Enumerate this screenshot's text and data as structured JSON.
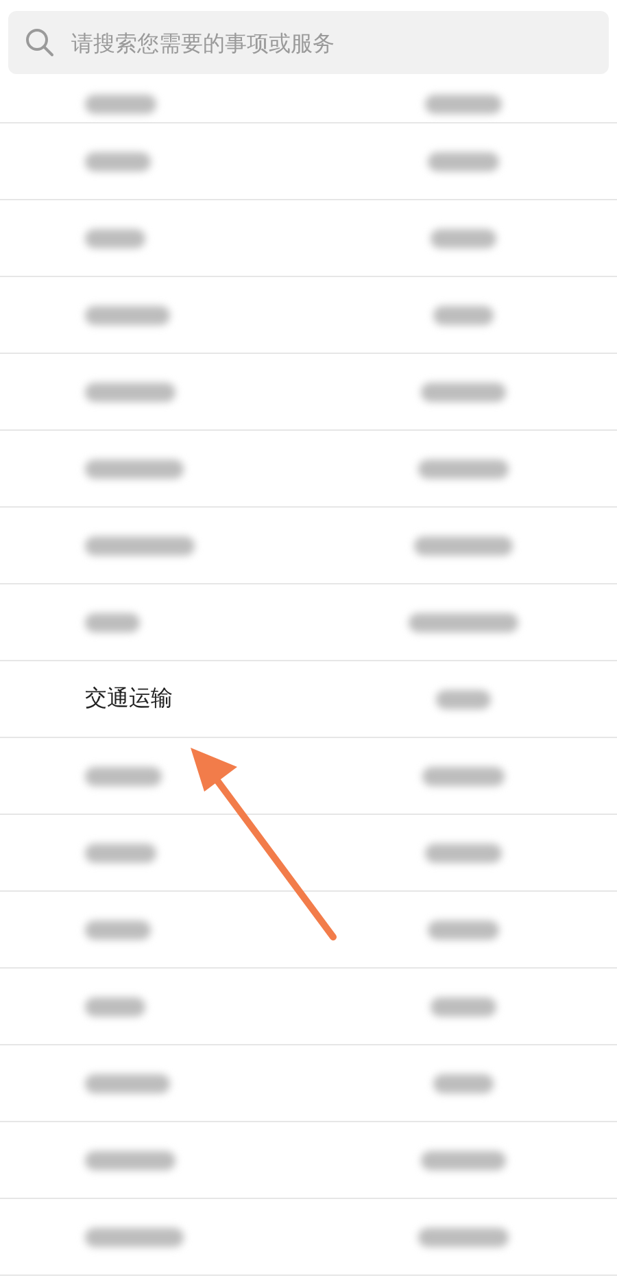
{
  "search": {
    "placeholder": "请搜索您需要的事项或服务"
  },
  "rows": [
    {
      "cells": [
        {
          "kind": "blurred"
        },
        {
          "kind": "blurred"
        }
      ]
    },
    {
      "cells": [
        {
          "kind": "blurred"
        },
        {
          "kind": "blurred"
        }
      ]
    },
    {
      "cells": [
        {
          "kind": "blurred"
        },
        {
          "kind": "blurred"
        }
      ]
    },
    {
      "cells": [
        {
          "kind": "blurred"
        },
        {
          "kind": "blurred"
        }
      ]
    },
    {
      "cells": [
        {
          "kind": "blurred"
        },
        {
          "kind": "blurred"
        }
      ]
    },
    {
      "cells": [
        {
          "kind": "blurred"
        },
        {
          "kind": "blurred"
        }
      ]
    },
    {
      "cells": [
        {
          "kind": "blurred"
        },
        {
          "kind": "blurred"
        }
      ]
    },
    {
      "cells": [
        {
          "kind": "blurred"
        },
        {
          "kind": "blurred"
        }
      ]
    },
    {
      "cells": [
        {
          "kind": "text",
          "text": "交通运输"
        },
        {
          "kind": "blurred"
        }
      ]
    },
    {
      "cells": [
        {
          "kind": "blurred"
        },
        {
          "kind": "blurred"
        }
      ]
    },
    {
      "cells": [
        {
          "kind": "blurred"
        },
        {
          "kind": "blurred"
        }
      ]
    },
    {
      "cells": [
        {
          "kind": "blurred"
        },
        {
          "kind": "blurred"
        }
      ]
    },
    {
      "cells": [
        {
          "kind": "blurred"
        },
        {
          "kind": "blurred"
        }
      ]
    },
    {
      "cells": [
        {
          "kind": "blurred"
        },
        {
          "kind": "blurred"
        }
      ]
    },
    {
      "cells": [
        {
          "kind": "blurred"
        },
        {
          "kind": "blurred"
        }
      ]
    },
    {
      "cells": [
        {
          "kind": "blurred"
        },
        {
          "kind": "blurred"
        }
      ]
    }
  ],
  "annotation": {
    "kind": "arrow"
  }
}
